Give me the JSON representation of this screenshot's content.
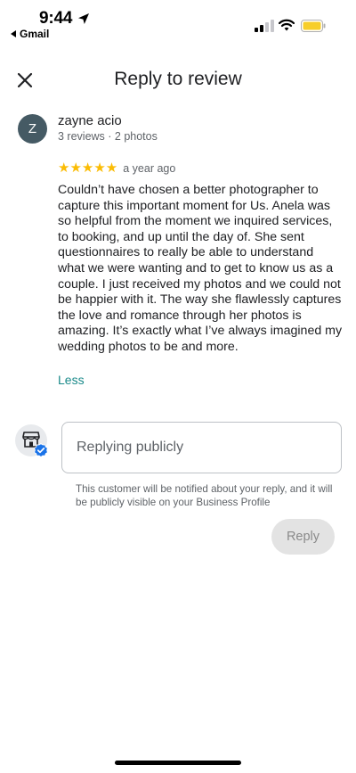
{
  "status_bar": {
    "time": "9:44",
    "back_app": "Gmail",
    "icons": [
      "location-arrow-icon",
      "signal-icon",
      "wifi-icon",
      "battery-icon"
    ]
  },
  "header": {
    "title": "Reply to review",
    "close_icon": "close-icon"
  },
  "review": {
    "avatar_initial": "Z",
    "reviewer_name": "zayne acio",
    "reviewer_meta": "3 reviews · 2 photos",
    "stars": "★★★★★",
    "rating": 5,
    "date": "a year ago",
    "text": "Couldn’t have chosen a better photographer to capture this important moment for Us. Anela was so helpful from the moment we inquired services, to booking, and up until the day of. She sent questionnaires to really be able to understand what we were wanting and to get to know us as a couple. I just received my photos and we could not be happier with it. The way she flawlessly captures the love and romance through her photos is amazing. It’s exactly what I’ve always imagined my wedding photos to be and more.",
    "less_label": "Less"
  },
  "reply": {
    "placeholder": "Replying publicly",
    "notice": "This customer will be notified about your reply, and it will be publicly visible on your Business Profile",
    "button_label": "Reply",
    "icons": [
      "store-icon",
      "verified-badge-icon"
    ]
  },
  "colors": {
    "star": "#fbbc04",
    "link": "#1a8a8a",
    "avatar": "#455a64",
    "battery": "#f7ce2a"
  }
}
